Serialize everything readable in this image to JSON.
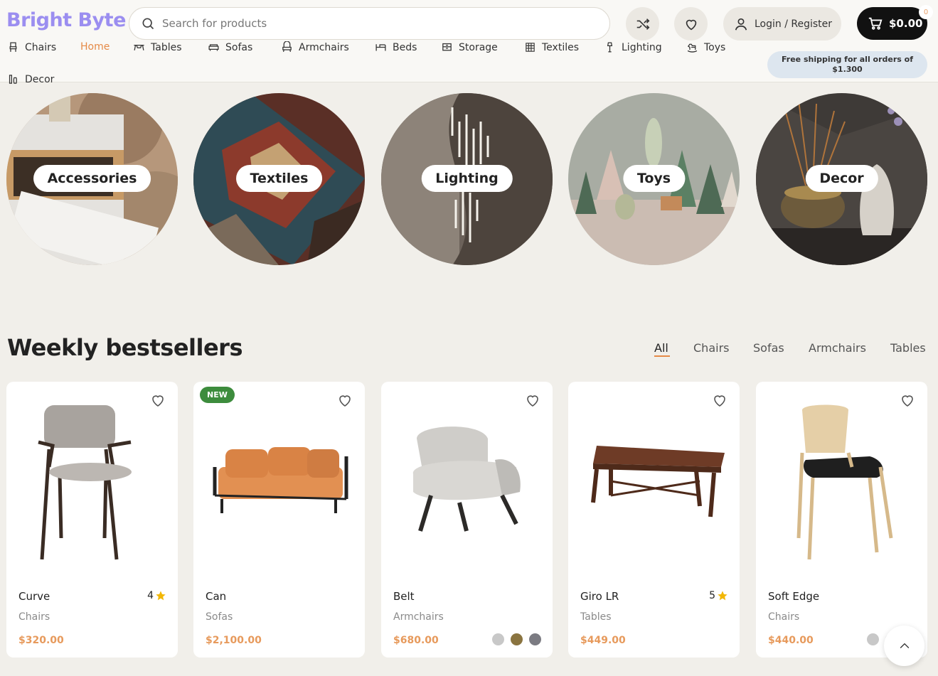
{
  "brand": {
    "name": "Bright Byte",
    "color": "#9b8ef0"
  },
  "search": {
    "placeholder": "Search for products"
  },
  "header": {
    "login_label": "Login / Register",
    "cart_total": "$0.00",
    "cart_count": "0",
    "shipping_note": "Free shipping for all orders of $1.300"
  },
  "nav": {
    "items": [
      {
        "label": "Chairs",
        "icon": "chair-icon"
      },
      {
        "label": "Home",
        "icon": ""
      },
      {
        "label": "Tables",
        "icon": "table-icon"
      },
      {
        "label": "Sofas",
        "icon": "sofa-icon"
      },
      {
        "label": "Armchairs",
        "icon": "armchair-icon"
      },
      {
        "label": "Beds",
        "icon": "bed-icon"
      },
      {
        "label": "Storage",
        "icon": "storage-icon"
      },
      {
        "label": "Textiles",
        "icon": "textiles-icon"
      },
      {
        "label": "Lighting",
        "icon": "lamp-icon"
      },
      {
        "label": "Toys",
        "icon": "rocking-horse-icon"
      },
      {
        "label": "Decor",
        "icon": "vase-icon"
      }
    ],
    "active": "Home"
  },
  "categories": [
    {
      "label": "Accessories"
    },
    {
      "label": "Textiles"
    },
    {
      "label": "Lighting"
    },
    {
      "label": "Toys"
    },
    {
      "label": "Decor"
    }
  ],
  "bestsellers": {
    "title": "Weekly bestsellers",
    "filters": [
      "All",
      "Chairs",
      "Sofas",
      "Armchairs",
      "Tables"
    ],
    "active_filter": "All",
    "products": [
      {
        "name": "Curve",
        "category": "Chairs",
        "price": "$320.00",
        "rating": "4",
        "badge": ""
      },
      {
        "name": "Can",
        "category": "Sofas",
        "price": "$2,100.00",
        "rating": "",
        "badge": "NEW"
      },
      {
        "name": "Belt",
        "category": "Armchairs",
        "price": "$680.00",
        "rating": "",
        "badge": "",
        "swatches": [
          "#c8c8c8",
          "#8a7440",
          "#7b7b82"
        ]
      },
      {
        "name": "Giro LR",
        "category": "Tables",
        "price": "$449.00",
        "rating": "5",
        "badge": ""
      },
      {
        "name": "Soft Edge",
        "category": "Chairs",
        "price": "$440.00",
        "rating": "",
        "badge": "",
        "swatches": [
          "#c8c8c8",
          "#dcdcdc",
          "#f2c9cf"
        ]
      }
    ]
  },
  "colors": {
    "accent": "#e58a47",
    "price": "#e79a5c",
    "star": "#f2b705",
    "new_badge": "#3d8c3d"
  }
}
